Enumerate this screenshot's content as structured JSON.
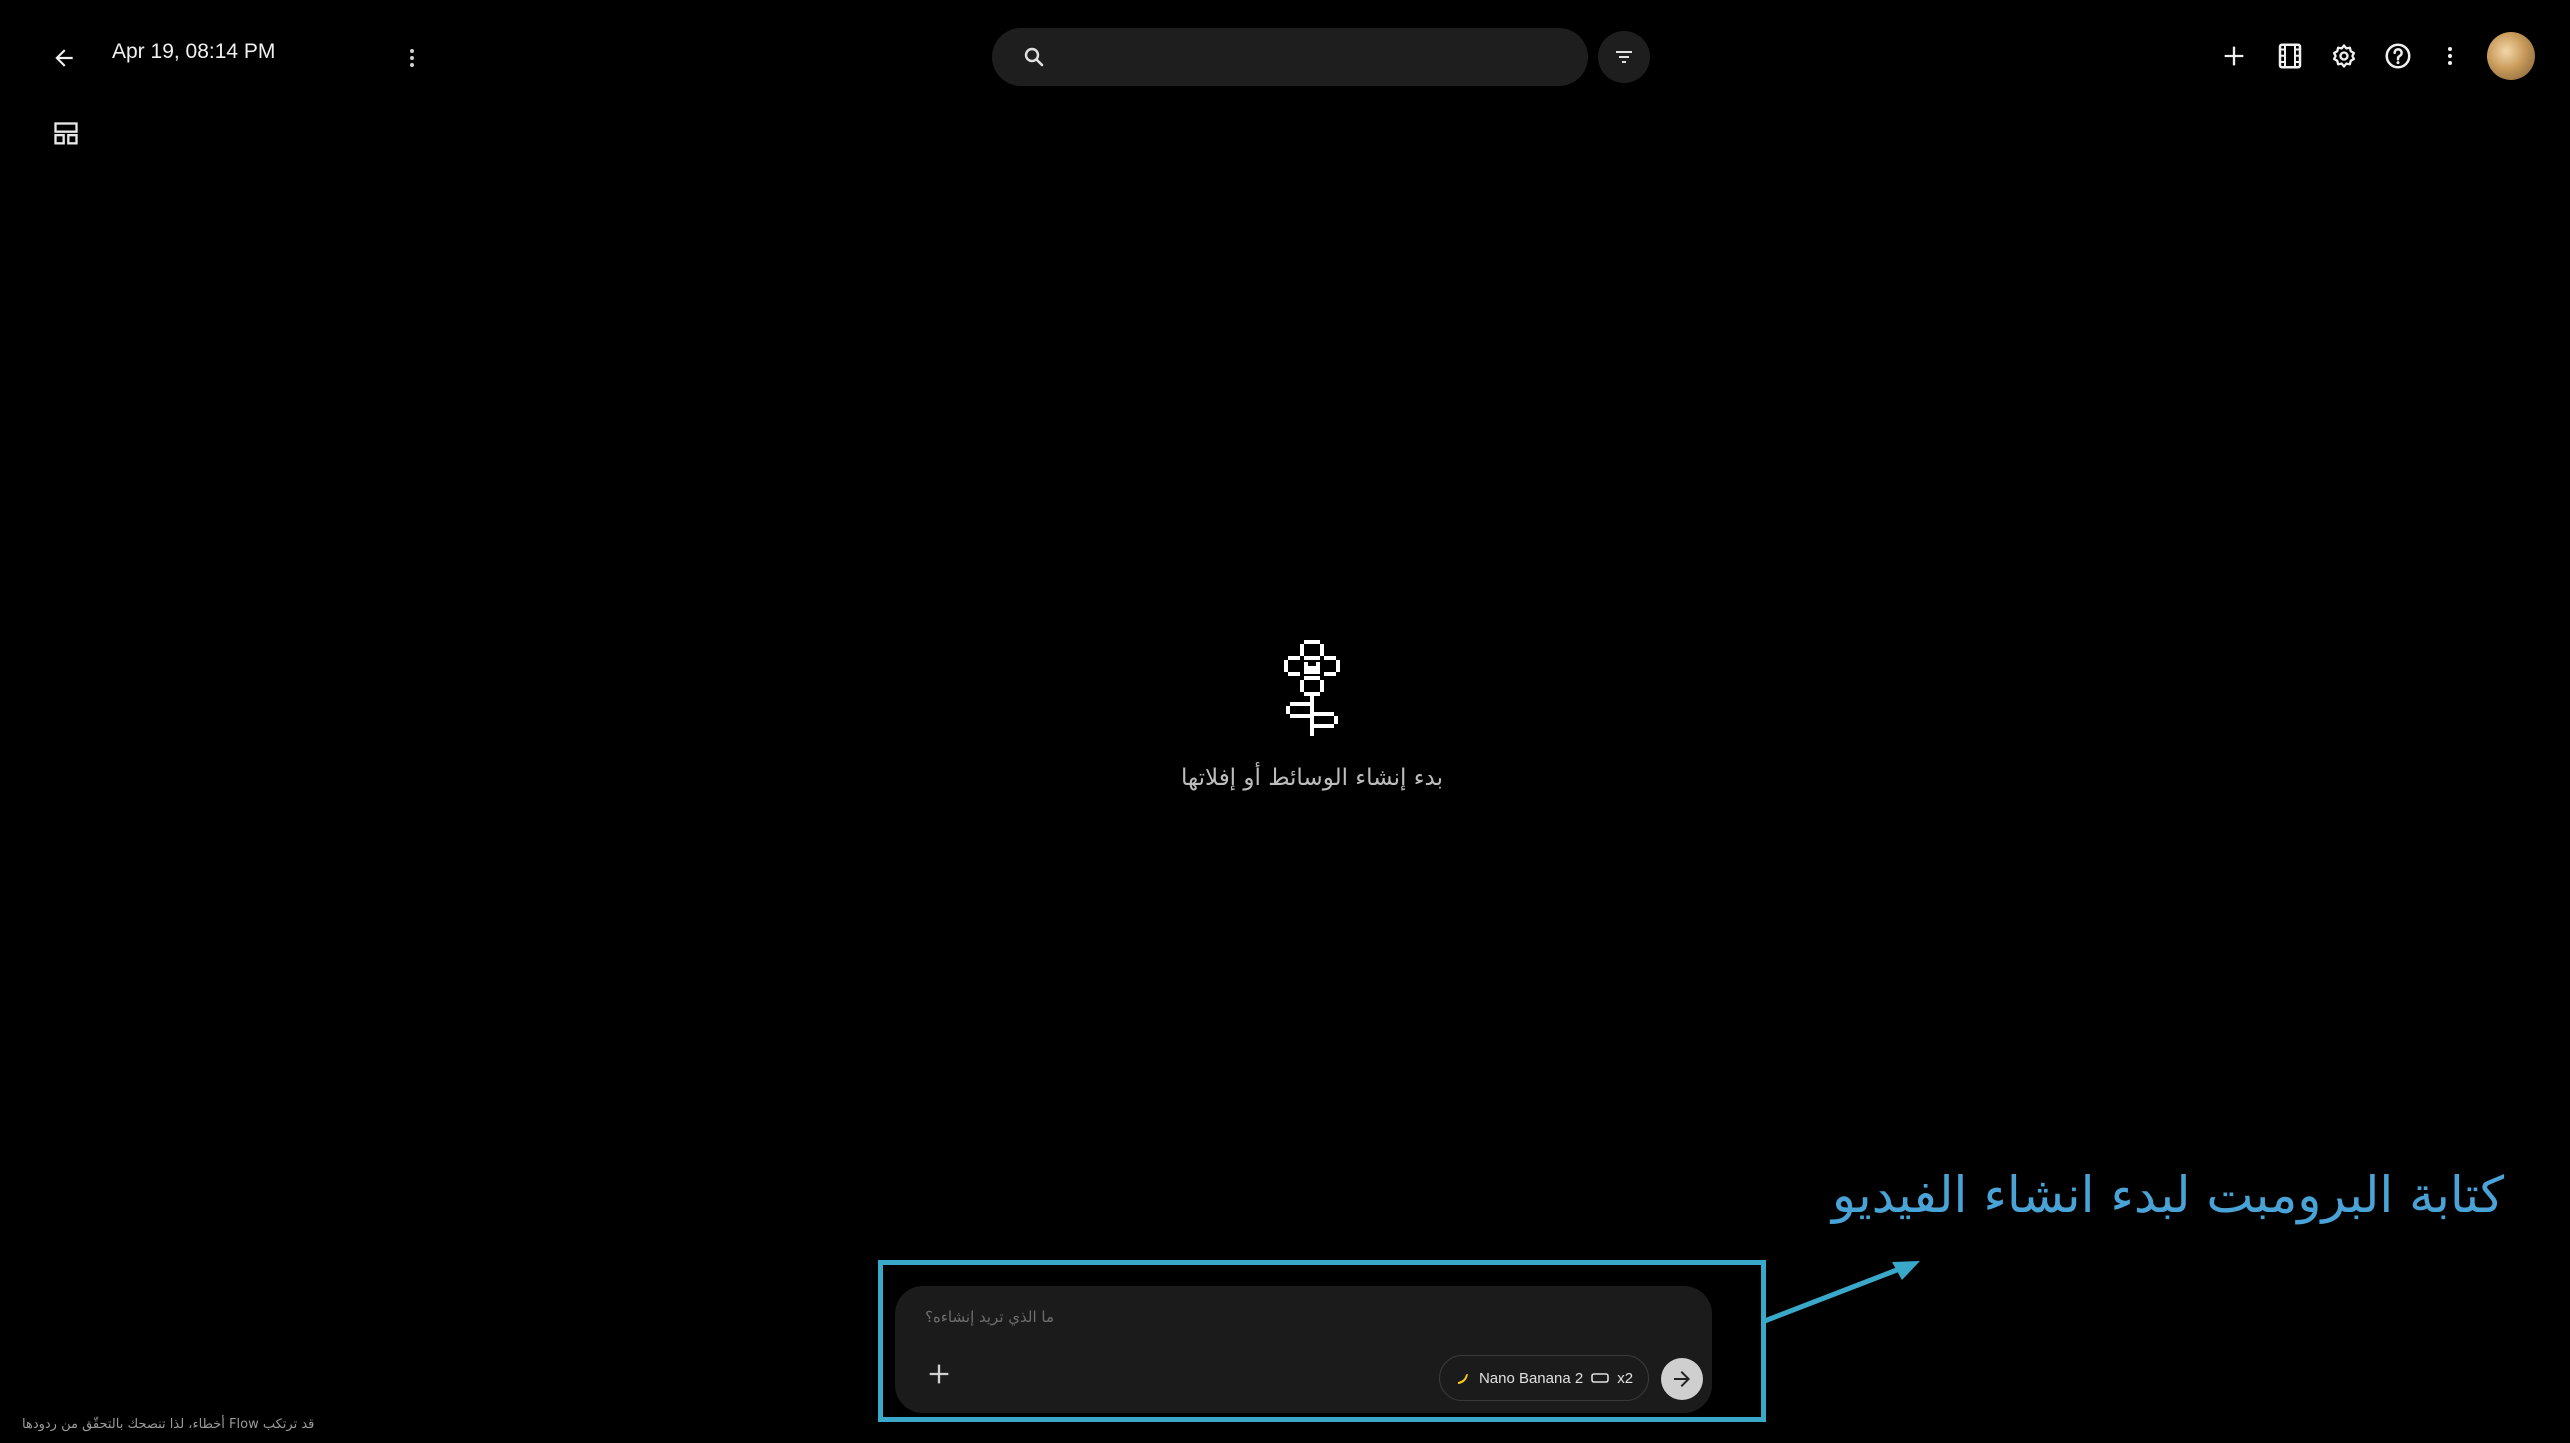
{
  "header": {
    "back_icon": "arrow-left-icon",
    "title": "Apr 19, 08:14 PM",
    "menu_icon": "more-vert-icon",
    "search": {
      "placeholder": "",
      "icon": "search-icon"
    },
    "filter_icon": "filter-icon",
    "actions": [
      {
        "name": "add-button",
        "icon": "plus-icon"
      },
      {
        "name": "scenebuilder-button",
        "icon": "film-icon"
      },
      {
        "name": "settings-button",
        "icon": "gear-icon"
      },
      {
        "name": "help-button",
        "icon": "help-circle-icon"
      },
      {
        "name": "more-button",
        "icon": "more-vert-icon"
      }
    ],
    "avatar_icon": "avatar"
  },
  "view_toggle_icon": "grid-view-icon",
  "empty_state": {
    "icon": "pixel-flower-icon",
    "text": "بدء إنشاء الوسائط أو إفلاتها"
  },
  "composer": {
    "placeholder": "ما الذي تريد إنشاءه؟",
    "add_icon": "plus-icon",
    "model_chip": {
      "icon": "banana-icon",
      "model": "Nano Banana 2",
      "aspect_icon": "aspect-ratio-icon",
      "count": "x2"
    },
    "send_icon": "arrow-right-icon"
  },
  "annotation": {
    "text": "كتابة البرومبت لبدء انشاء الفيديو",
    "color": "#4aa3d6",
    "box_color": "#3aa9c9"
  },
  "footer_note": "قد ترتكب Flow أخطاء، لذا تنصحك بالتحقّق من ردودها"
}
